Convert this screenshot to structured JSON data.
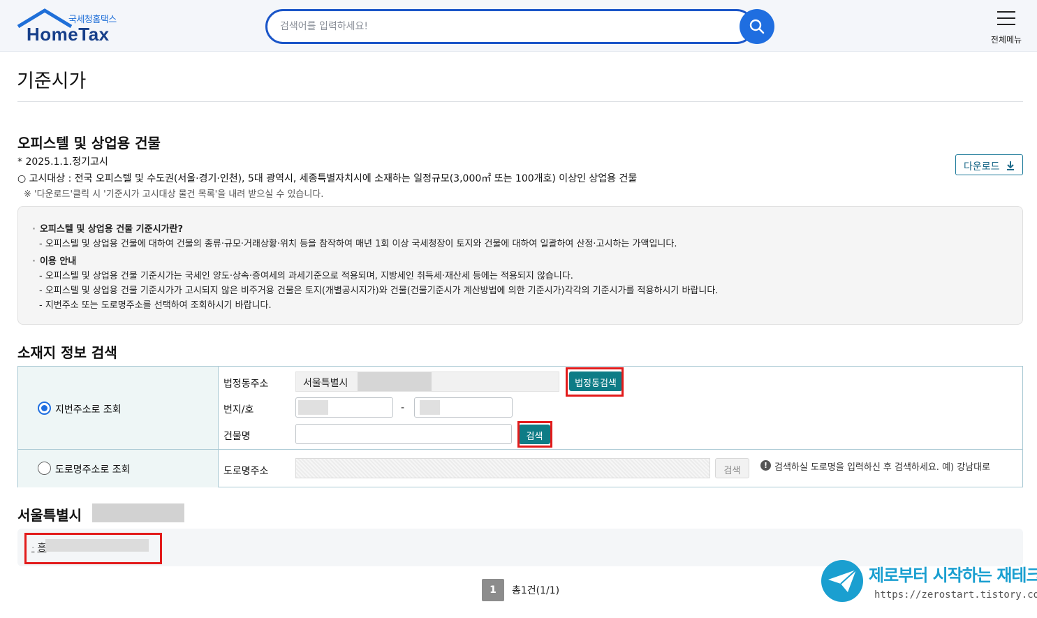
{
  "header": {
    "logo_sub": "국세청홈택스",
    "logo_main": "HomeTax",
    "search_placeholder": "검색어를 입력하세요!",
    "menu_label": "전체메뉴"
  },
  "page": {
    "title": "기준시가"
  },
  "section": {
    "title": "오피스텔 및 상업용 건물",
    "notice_date": "* 2025.1.1.정기고시",
    "notice_target": "○ 고시대상 : 전국 오피스텔 및 수도권(서울·경기·인천), 5대 광역시, 세종특별자치시에 소재하는 일정규모(3,000㎡ 또는 100개호) 이상인 상업용 건물",
    "notice_download": "※ '다운로드'클릭 시 '기준시가 고시대상 물건 목록'을 내려 받으실 수 있습니다.",
    "download_label": "다운로드"
  },
  "info": {
    "head1": "오피스텔 및 상업용 건물 기준시가란?",
    "line1": "- 오피스텔 및 상업용 건물에 대하여 건물의 종류·규모·거래상황·위치 등을 참작하여 매년 1회 이상 국세청장이 토지와 건물에 대하여 일괄하여 산정·고시하는 가액입니다.",
    "head2": "이용 안내",
    "line2": "- 오피스텔 및 상업용 건물 기준시가는 국세인 양도·상속·증여세의 과세기준으로 적용되며, 지방세인 취득세·재산세 등에는 적용되지 않습니다.",
    "line3": "- 오피스텔 및 상업용 건물 기준시가가 고시되지 않은 비주거용 건물은 토지(개별공시지가)와 건물(건물기준시가 계산방법에 의한 기준시가)각각의 기준시가를 적용하시기 바랍니다.",
    "line4": "- 지번주소 또는 도로명주소를 선택하여 조회하시기 바랍니다."
  },
  "search": {
    "title": "소재지 정보 검색",
    "radio_jibun": "지번주소로 조회",
    "radio_road": "도로명주소로 조회",
    "label_legal": "법정동주소",
    "legal_value": "서울특별시",
    "btn_legal_search": "법정동검색",
    "label_bunji": "번지/호",
    "dash": "-",
    "label_building": "건물명",
    "btn_search": "검색",
    "label_road": "도로명주소",
    "btn_road_search": "검색",
    "road_hint": "검색하실 도로명을 입력하신 후 검색하세요. 예) 강남대로"
  },
  "results": {
    "title": "서울특별시",
    "item": "흥"
  },
  "pagination": {
    "current": "1",
    "total": "총1건(1/1)"
  },
  "watermark": {
    "title": "제로부터 시작하는 재테크",
    "url": "https://zerostart.tistory.com/"
  },
  "colors": {
    "brand_blue": "#1f6ee0",
    "teal": "#0e7c86",
    "highlight_red": "#e21b1b"
  }
}
